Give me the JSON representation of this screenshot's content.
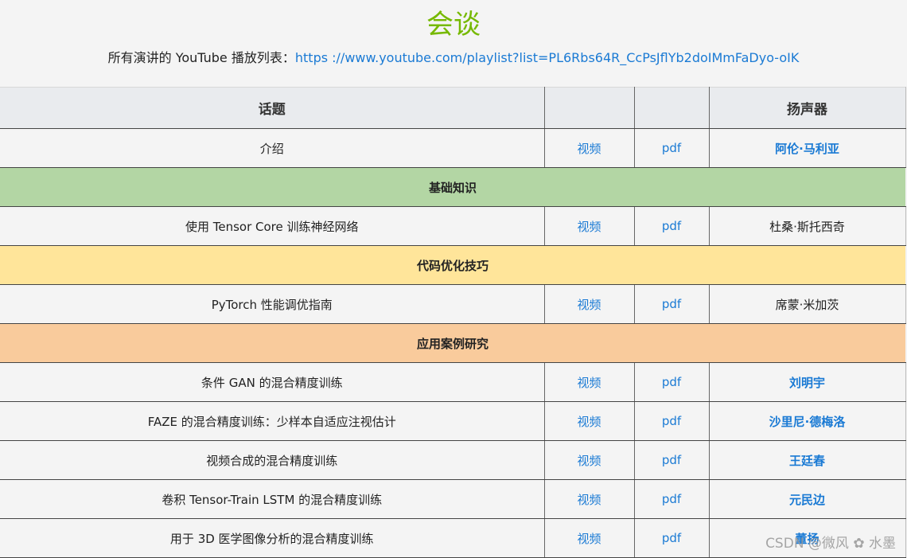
{
  "page": {
    "title": "会谈",
    "playlist_label": "所有演讲的 YouTube 播放列表：",
    "playlist_url": "https ://www.youtube.com/playlist?list=PL6Rbs64R_CcPsJflYb2doIMmFaDyo-oIK"
  },
  "table": {
    "headers": [
      "话题",
      "",
      "",
      "扬声器"
    ],
    "rows": [
      {
        "kind": "talk",
        "topic": "介绍",
        "video": "视频",
        "pdf": "pdf",
        "speaker": "阿伦·马利亚",
        "speaker_link": true
      },
      {
        "kind": "section",
        "label": "基础知识",
        "color": "#b3d6a4"
      },
      {
        "kind": "talk",
        "topic": "使用 Tensor Core 训练神经网络",
        "video": "视频",
        "pdf": "pdf",
        "speaker": "杜桑·斯托西奇",
        "speaker_link": false
      },
      {
        "kind": "section",
        "label": "代码优化技巧",
        "color": "#ffe59a"
      },
      {
        "kind": "talk",
        "topic": "PyTorch 性能调优指南",
        "video": "视频",
        "pdf": "pdf",
        "speaker": "席蒙·米加茨",
        "speaker_link": false
      },
      {
        "kind": "section",
        "label": "应用案例研究",
        "color": "#f9cb9c"
      },
      {
        "kind": "talk",
        "topic": "条件 GAN 的混合精度训练",
        "video": "视频",
        "pdf": "pdf",
        "speaker": "刘明宇",
        "speaker_link": true
      },
      {
        "kind": "talk",
        "topic": "FAZE 的混合精度训练：少样本自适应注视估计",
        "video": "视频",
        "pdf": "pdf",
        "speaker": "沙里尼·德梅洛",
        "speaker_link": true
      },
      {
        "kind": "talk",
        "topic": "视频合成的混合精度训练",
        "video": "视频",
        "pdf": "pdf",
        "speaker": "王廷春",
        "speaker_link": true
      },
      {
        "kind": "talk",
        "topic": "卷积 Tensor-Train LSTM 的混合精度训练",
        "video": "视频",
        "pdf": "pdf",
        "speaker": "元民边",
        "speaker_link": true
      },
      {
        "kind": "talk",
        "topic": "用于 3D 医学图像分析的混合精度训练",
        "video": "视频",
        "pdf": "pdf",
        "speaker": "董扬",
        "speaker_link": true
      }
    ]
  },
  "watermark": "CSDN @微风 ✿ 水墨"
}
